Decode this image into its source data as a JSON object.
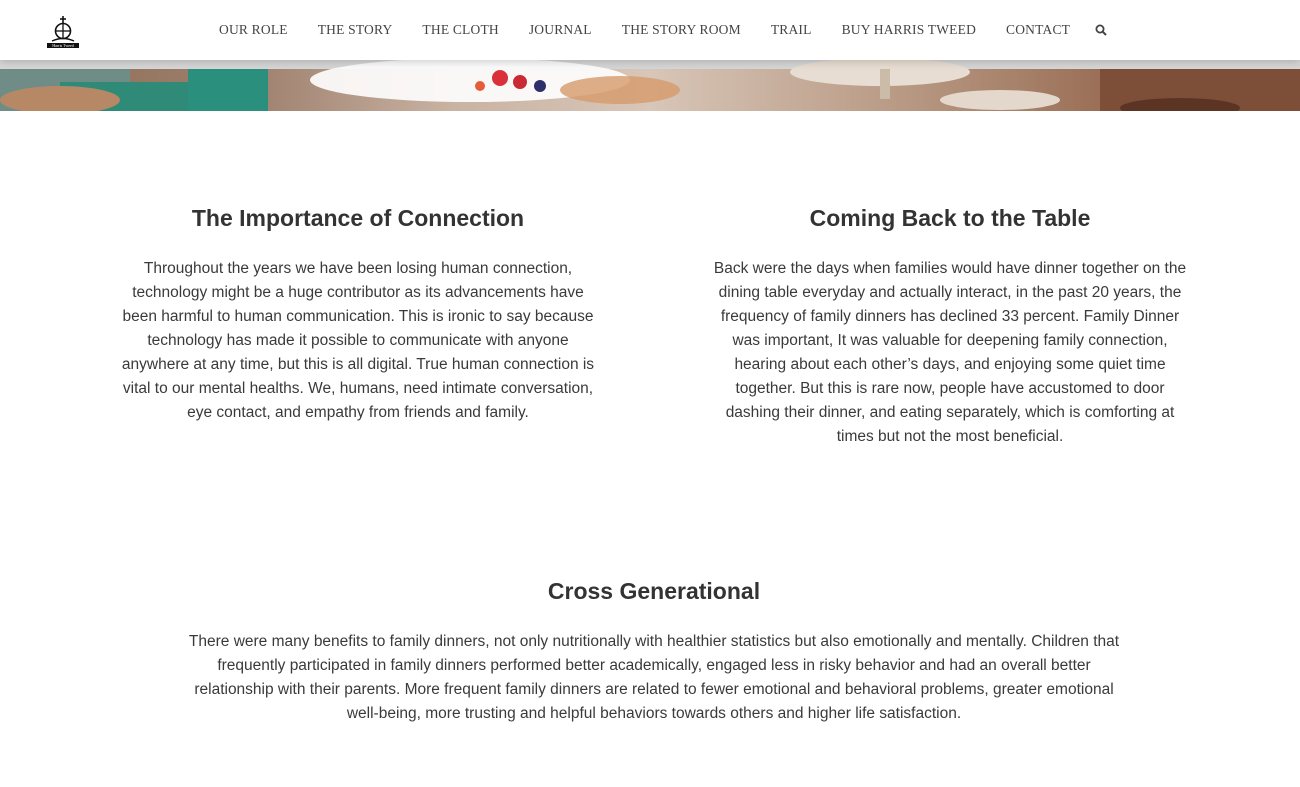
{
  "nav": {
    "items": [
      "OUR ROLE",
      "THE STORY",
      "THE CLOTH",
      "JOURNAL",
      "THE STORY ROOM",
      "TRAIL",
      "BUY HARRIS TWEED",
      "CONTACT"
    ],
    "logo_text": "Harris Tweed"
  },
  "sections": {
    "connection": {
      "title": "The Importance of Connection",
      "body": "Throughout the years we have been losing human connection, technology might be a huge contributor as its advancements have been harmful to human communication. This is ironic to say because technology has made it possible to communicate with anyone anywhere at any time, but this is all digital. True human connection is vital to our mental healths. We, humans, need intimate conversation, eye contact, and empathy from friends and family."
    },
    "table": {
      "title": "Coming Back to the Table",
      "body": "Back were the days when families would have dinner together on the dining table everyday and actually interact, in the past 20 years, the frequency of family dinners has declined 33 percent. Family Dinner was important, It was valuable for deepening family connection, hearing about each other’s days, and enjoying some quiet time together. But this is rare now, people have accustomed to door dashing their dinner, and eating separately, which is comforting at times but not the most beneficial."
    },
    "cross": {
      "title": "Cross Generational",
      "body": "There were many benefits to family dinners, not only nutritionally with healthier statistics but also emotionally and mentally. Children that frequently participated in family dinners performed better academically, engaged less in risky behavior and had an overall better relationship with their parents. More frequent family dinners are related to fewer emotional and behavioral problems, greater emotional well-being, more trusting and helpful behaviors towards others and higher life satisfaction."
    }
  },
  "icons": {
    "logo": "harris-tweed-orb-logo",
    "search": "search-icon"
  },
  "colors": {
    "text": "#333333",
    "nav_text": "#444444",
    "background": "#ffffff"
  }
}
